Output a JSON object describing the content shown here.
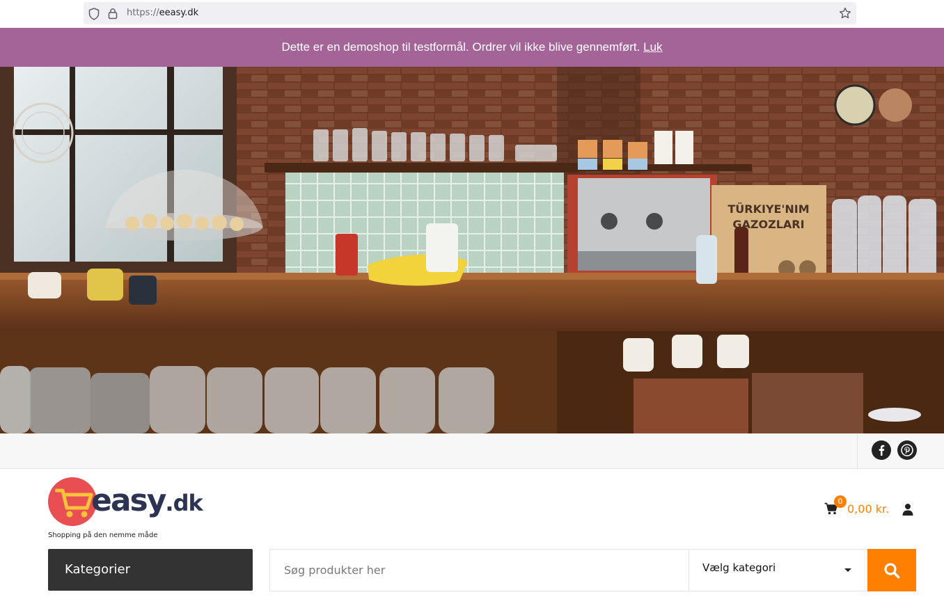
{
  "browser": {
    "url_protocol": "https://",
    "url_host": "eeasy.dk"
  },
  "notice": {
    "text": "Dette er en demoshop til testformål. Ordrer vil ikke blive gennemført.",
    "dismiss_label": "Luk"
  },
  "hero": {
    "jar_label": "TÜRKIYE'NIM GAZOZLARI"
  },
  "social": {
    "items": [
      "facebook-icon",
      "pinterest-icon"
    ]
  },
  "header": {
    "logo_main": "easy",
    "logo_suffix": ".dk",
    "tagline": "Shopping på den nemme måde",
    "cart_count": "0",
    "cart_total": "0,00 kr."
  },
  "nav": {
    "categories_label": "Kategorier",
    "search_placeholder": "Søg produkter her",
    "category_select_label": "Vælg kategori"
  },
  "colors": {
    "notice_bg": "#a46497",
    "accent": "#ff7f00",
    "logo_circle": "#e94e53",
    "logo_text": "#2d3453",
    "dark_button": "#333333"
  }
}
